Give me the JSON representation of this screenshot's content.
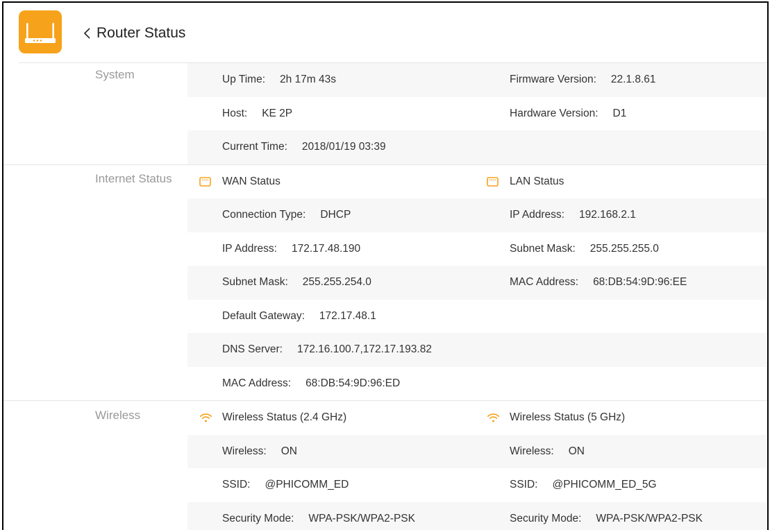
{
  "theme": {
    "accent": "#f7a21b",
    "stripe": "#f7f7f7",
    "text": "#333333",
    "muted": "#999999",
    "divider": "#e5e5e5",
    "frame": "#000000",
    "title": "#222222"
  },
  "header": {
    "logo_icon": "router-icon",
    "back_icon": "chevron-left-icon",
    "title": "Router Status"
  },
  "system": {
    "label": "System",
    "rows": [
      {
        "left": {
          "label": "Up Time:",
          "value": "2h 17m 43s"
        },
        "right": {
          "label": "Firmware Version:",
          "value": "22.1.8.61"
        }
      },
      {
        "left": {
          "label": "Host:",
          "value": "KE 2P"
        },
        "right": {
          "label": "Hardware Version:",
          "value": "D1"
        }
      },
      {
        "left": {
          "label": "Current Time:",
          "value": "2018/01/19 03:39"
        }
      }
    ]
  },
  "internet": {
    "label": "Internet Status",
    "wan": {
      "icon": "ethernet-port-icon",
      "title": "WAN Status"
    },
    "lan": {
      "icon": "ethernet-port-icon",
      "title": "LAN Status"
    },
    "rows": [
      {
        "left": {
          "label": "Connection Type:",
          "value": "DHCP"
        },
        "right": {
          "label": "IP Address:",
          "value": "192.168.2.1"
        }
      },
      {
        "left": {
          "label": "IP Address:",
          "value": "172.17.48.190"
        },
        "right": {
          "label": "Subnet Mask:",
          "value": "255.255.255.0"
        }
      },
      {
        "left": {
          "label": "Subnet Mask:",
          "value": "255.255.254.0"
        },
        "right": {
          "label": "MAC Address:",
          "value": "68:DB:54:9D:96:EE"
        }
      },
      {
        "left": {
          "label": "Default Gateway:",
          "value": "172.17.48.1"
        }
      },
      {
        "left": {
          "label": "DNS Server:",
          "value": "172.16.100.7,172.17.193.82"
        }
      },
      {
        "left": {
          "label": "MAC Address:",
          "value": "68:DB:54:9D:96:ED"
        }
      }
    ]
  },
  "wireless": {
    "label": "Wireless",
    "band_24": {
      "icon": "wifi-icon",
      "title": "Wireless Status (2.4 GHz)"
    },
    "band_5": {
      "icon": "wifi-icon",
      "title": "Wireless Status (5 GHz)"
    },
    "rows": [
      {
        "left": {
          "label": "Wireless:",
          "value": "ON"
        },
        "right": {
          "label": "Wireless:",
          "value": "ON"
        }
      },
      {
        "left": {
          "label": "SSID:",
          "value": "@PHICOMM_ED"
        },
        "right": {
          "label": "SSID:",
          "value": "@PHICOMM_ED_5G"
        }
      },
      {
        "left": {
          "label": "Security Mode:",
          "value": "WPA-PSK/WPA2-PSK"
        },
        "right": {
          "label": "Security Mode:",
          "value": "WPA-PSK/WPA2-PSK"
        }
      }
    ]
  }
}
